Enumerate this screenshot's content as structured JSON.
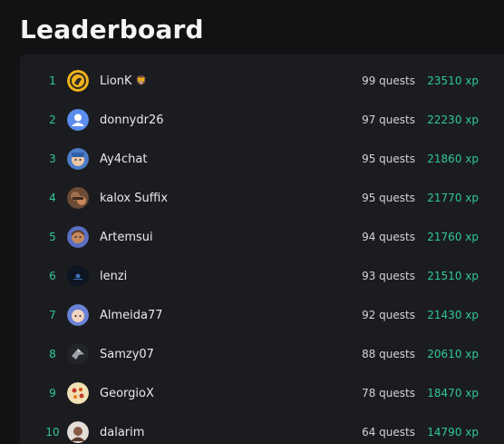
{
  "header": {
    "title": "Leaderboard"
  },
  "accent_color": "#2fc79a",
  "rows": [
    {
      "rank": "1",
      "name": "LionK",
      "badge": "🦁",
      "quests": "99 quests",
      "xp": "23510 xp",
      "avatar": "lion-avatar-icon"
    },
    {
      "rank": "2",
      "name": "donnydr26",
      "badge": "",
      "quests": "97 quests",
      "xp": "22230 xp",
      "avatar": "default-user-avatar-icon"
    },
    {
      "rank": "3",
      "name": "Ay4chat",
      "badge": "",
      "quests": "95 quests",
      "xp": "21860 xp",
      "avatar": "cartoon-avatar-icon"
    },
    {
      "rank": "4",
      "name": "kalox Suffix",
      "badge": "",
      "quests": "95 quests",
      "xp": "21770 xp",
      "avatar": "photo-avatar-icon"
    },
    {
      "rank": "5",
      "name": "Artemsui",
      "badge": "",
      "quests": "94 quests",
      "xp": "21760 xp",
      "avatar": "cartoon-avatar-icon"
    },
    {
      "rank": "6",
      "name": "lenzi",
      "badge": "",
      "quests": "93 quests",
      "xp": "21510 xp",
      "avatar": "dark-logo-avatar-icon"
    },
    {
      "rank": "7",
      "name": "Almeida77",
      "badge": "",
      "quests": "92 quests",
      "xp": "21430 xp",
      "avatar": "cartoon-avatar-icon"
    },
    {
      "rank": "8",
      "name": "Samzy07",
      "badge": "",
      "quests": "88 quests",
      "xp": "20610 xp",
      "avatar": "bird-avatar-icon"
    },
    {
      "rank": "9",
      "name": "GeorgioX",
      "badge": "",
      "quests": "78 quests",
      "xp": "18470 xp",
      "avatar": "pattern-avatar-icon"
    },
    {
      "rank": "10",
      "name": "dalarim",
      "badge": "",
      "quests": "64 quests",
      "xp": "14790 xp",
      "avatar": "photo-avatar-icon"
    }
  ]
}
